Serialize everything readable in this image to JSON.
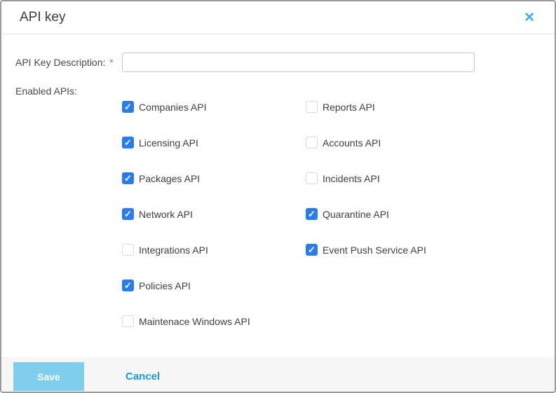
{
  "dialog": {
    "title": "API key",
    "close_icon": "✕"
  },
  "form": {
    "description_label": "API Key Description:",
    "required_marker": "*",
    "description_value": "",
    "enabled_apis_label": "Enabled APIs:"
  },
  "checkboxes": {
    "left": [
      {
        "label": "Companies API",
        "checked": true
      },
      {
        "label": "Licensing API",
        "checked": true
      },
      {
        "label": "Packages API",
        "checked": true
      },
      {
        "label": "Network API",
        "checked": true
      },
      {
        "label": "Integrations API",
        "checked": false
      },
      {
        "label": "Policies API",
        "checked": true
      },
      {
        "label": "Maintenace Windows API",
        "checked": false
      }
    ],
    "right": [
      {
        "label": "Reports API",
        "checked": false
      },
      {
        "label": "Accounts API",
        "checked": false
      },
      {
        "label": "Incidents API",
        "checked": false
      },
      {
        "label": "Quarantine API",
        "checked": true
      },
      {
        "label": "Event Push Service API",
        "checked": true
      }
    ]
  },
  "footer": {
    "save_label": "Save",
    "cancel_label": "Cancel"
  },
  "colors": {
    "checkbox_checked": "#2b7ceb",
    "close_icon": "#3aade3",
    "save_button_bg": "#7fceec",
    "cancel_text": "#179bd7",
    "footer_bg": "#f7f7f7"
  }
}
